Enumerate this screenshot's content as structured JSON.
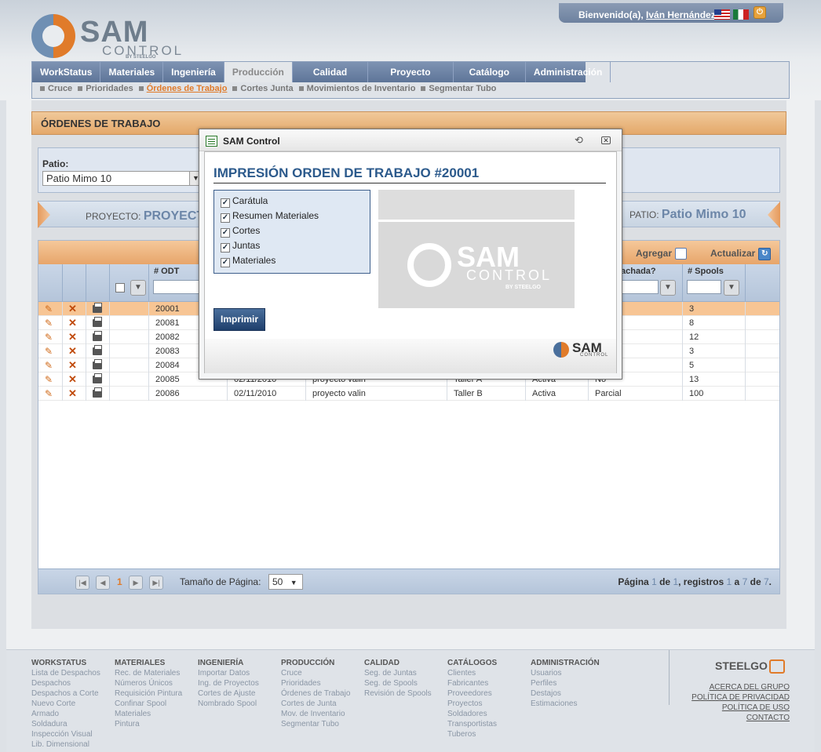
{
  "header": {
    "welcome_prefix": "Bienvenido(a), ",
    "user_name": "Iván Hernández",
    "logo_main": "SAM",
    "logo_sub": "CONTROL",
    "logo_by": "BY STEELGO"
  },
  "tabs": [
    "WorkStatus",
    "Materiales",
    "Ingeniería",
    "Producción",
    "Calidad",
    "Proyecto",
    "Catálogo",
    "Administración"
  ],
  "subnav": [
    "Cruce",
    "Prioridades",
    "Órdenes de Trabajo",
    "Cortes Junta",
    "Movimientos de Inventario",
    "Segmentar Tubo"
  ],
  "page_title": "ÓRDENES DE TRABAJO",
  "filter": {
    "label": "Patio:",
    "value": "Patio Mimo 10"
  },
  "project_bar": {
    "project_label": "PROYECTO:",
    "project_value": "PROYECT",
    "patio_label": "PATIO:",
    "patio_value": "Patio Mimo 10"
  },
  "grid": {
    "add_label": "Agregar",
    "refresh_label": "Actualizar",
    "col_odt": "# ODT",
    "col_despachada": "achada?",
    "col_spools": "# Spools",
    "rows": [
      {
        "odt": "20001",
        "fecha": "",
        "proyecto": "",
        "taller": "",
        "estatus": "",
        "desp": "",
        "spools": "3"
      },
      {
        "odt": "20081",
        "fecha": "",
        "proyecto": "",
        "taller": "",
        "estatus": "",
        "desp": "",
        "spools": "8"
      },
      {
        "odt": "20082",
        "fecha": "",
        "proyecto": "",
        "taller": "",
        "estatus": "",
        "desp": "",
        "spools": "12"
      },
      {
        "odt": "20083",
        "fecha": "",
        "proyecto": "",
        "taller": "",
        "estatus": "",
        "desp": "",
        "spools": "3"
      },
      {
        "odt": "20084",
        "fecha": "",
        "proyecto": "",
        "taller": "",
        "estatus": "",
        "desp": "",
        "spools": "5"
      },
      {
        "odt": "20085",
        "fecha": "02/11/2010",
        "proyecto": "proyecto valin",
        "taller": "Taller A",
        "estatus": "Activa",
        "desp": "No",
        "spools": "13"
      },
      {
        "odt": "20086",
        "fecha": "02/11/2010",
        "proyecto": "proyecto valin",
        "taller": "Taller B",
        "estatus": "Activa",
        "desp": "Parcial",
        "spools": "100"
      }
    ]
  },
  "pager": {
    "current_page": "1",
    "page_size_label": "Tamaño de Página:",
    "page_size": "50",
    "info_pagina": "Página",
    "info_cur": "1",
    "info_de": "de",
    "info_total": "1",
    "info_registros": ", registros",
    "info_from": "1",
    "info_a": "a",
    "info_to": "7",
    "info_de2": "de",
    "info_count": "7",
    "info_end": "."
  },
  "modal": {
    "window_title": "SAM Control",
    "heading": "IMPRESIÓN ORDEN DE TRABAJO #20001",
    "options": [
      "Carátula",
      "Resumen Materiales",
      "Cortes",
      "Juntas",
      "Materiales"
    ],
    "print_label": "Imprimir",
    "preview_main": "SAM",
    "preview_sub": "CONTROL",
    "preview_by": "BY STEELGO",
    "mini_logo": "SAM",
    "mini_sub": "CONTROL"
  },
  "footer": {
    "columns": [
      {
        "title": "WORKSTATUS",
        "items": [
          "Lista de Despachos",
          "Despachos",
          "Despachos a Corte",
          "Nuevo Corte",
          "Armado",
          "Soldadura",
          "Inspección Visual",
          "Lib. Dimensional"
        ]
      },
      {
        "title": "MATERIALES",
        "items": [
          "Rec. de Materiales",
          "Números Únicos",
          "Requisición Pintura",
          "Confinar Spool",
          "Materiales",
          "Pintura"
        ]
      },
      {
        "title": "INGENIERÍA",
        "items": [
          "Importar Datos",
          "Ing. de Proyectos",
          "Cortes de Ajuste",
          "Nombrado Spool"
        ]
      },
      {
        "title": "PRODUCCIÓN",
        "items": [
          "Cruce",
          "Prioridades",
          "Órdenes de Trabajo",
          "Cortes de Junta",
          "Mov. de Inventario",
          "Segmentar Tubo"
        ]
      },
      {
        "title": "CALIDAD",
        "items": [
          "Seg. de Juntas",
          "Seg. de Spools",
          "Revisión de Spools"
        ]
      },
      {
        "title": "CATÁLOGOS",
        "items": [
          "Clientes",
          "Fabricantes",
          "Proveedores",
          "Proyectos",
          "Soldadores",
          "Transportistas",
          "Tuberos"
        ]
      },
      {
        "title": "ADMINISTRACIÓN",
        "items": [
          "Usuarios",
          "Perfiles",
          "Destajos",
          "Estimaciones"
        ]
      }
    ],
    "brand": "STEELGO",
    "links": [
      "ACERCA DEL GRUPO",
      "POLÍTICA DE PRIVACIDAD",
      "POLÍTICA DE USO",
      "CONTACTO"
    ]
  },
  "colors": {
    "accent": "#e07b2a",
    "nav": "#6d819f",
    "heading": "#2c5a8c"
  }
}
